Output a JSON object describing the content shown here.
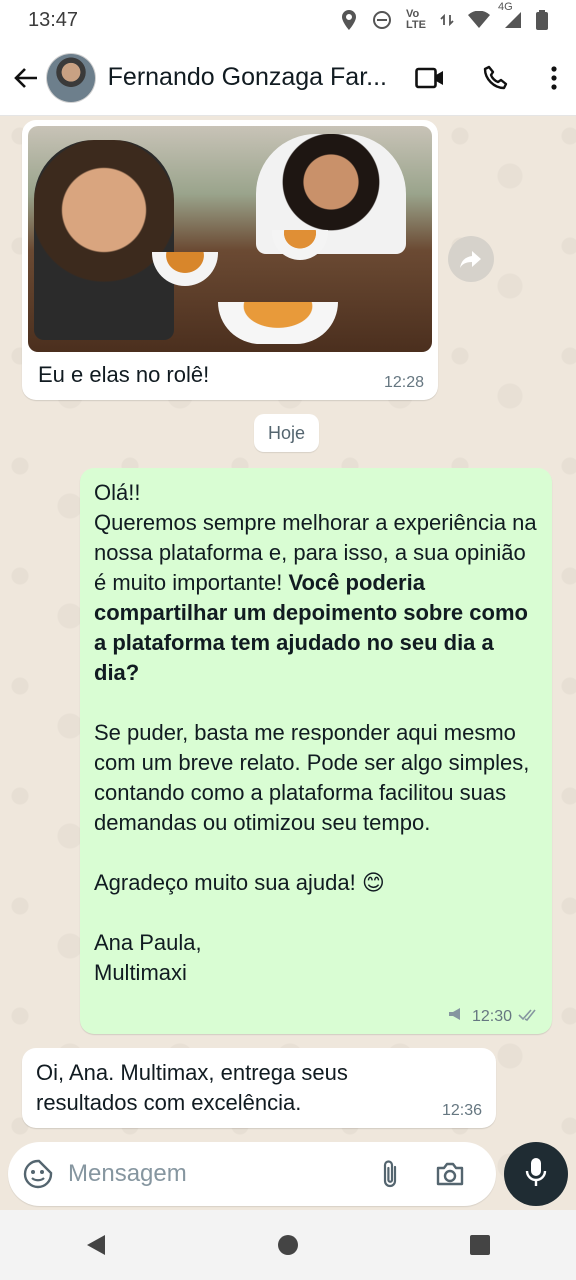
{
  "status_bar": {
    "time": "13:47",
    "icons": [
      "location-icon",
      "dnd-icon",
      "volte-icon",
      "data-icon",
      "wifi-icon",
      "signal-icon",
      "battery-icon"
    ],
    "volte_label": "Vo\nLTE",
    "network_label": "4G"
  },
  "header": {
    "contact_name": "Fernando Gonzaga Far...",
    "icons": [
      "back-icon",
      "video-call-icon",
      "voice-call-icon",
      "more-menu-icon"
    ]
  },
  "messages": [
    {
      "direction": "incoming",
      "type": "image",
      "caption": "Eu e elas no rolê!",
      "time": "12:28"
    },
    {
      "type": "date_chip",
      "label": "Hoje"
    },
    {
      "direction": "outgoing",
      "type": "text",
      "greeting": "Olá!!",
      "line1": "Queremos sempre melhorar a experiência na nossa plataforma e, para isso, a sua opinião é muito importante! ",
      "bold": "Você poderia compartilhar um depoimento sobre como a plataforma tem ajudado no seu dia a dia?",
      "para2": "Se puder, basta me responder aqui mesmo com um breve relato. Pode ser algo simples, contando como a plataforma facilitou suas demandas ou otimizou seu tempo.",
      "thanks": "Agradeço muito sua ajuda! 😊",
      "signature": "Ana Paula,\nMultimaxi",
      "time": "12:30",
      "status": "read"
    },
    {
      "direction": "incoming",
      "type": "text",
      "text": "Oi, Ana. Multimax, entrega seus resultados com excelência.",
      "time": "12:36"
    }
  ],
  "composer": {
    "placeholder": "Mensagem"
  },
  "colors": {
    "outgoing_bubble": "#d9fdd3",
    "incoming_bubble": "#ffffff",
    "mic_button": "#1f2c33",
    "chat_background": "#efe7dc"
  }
}
